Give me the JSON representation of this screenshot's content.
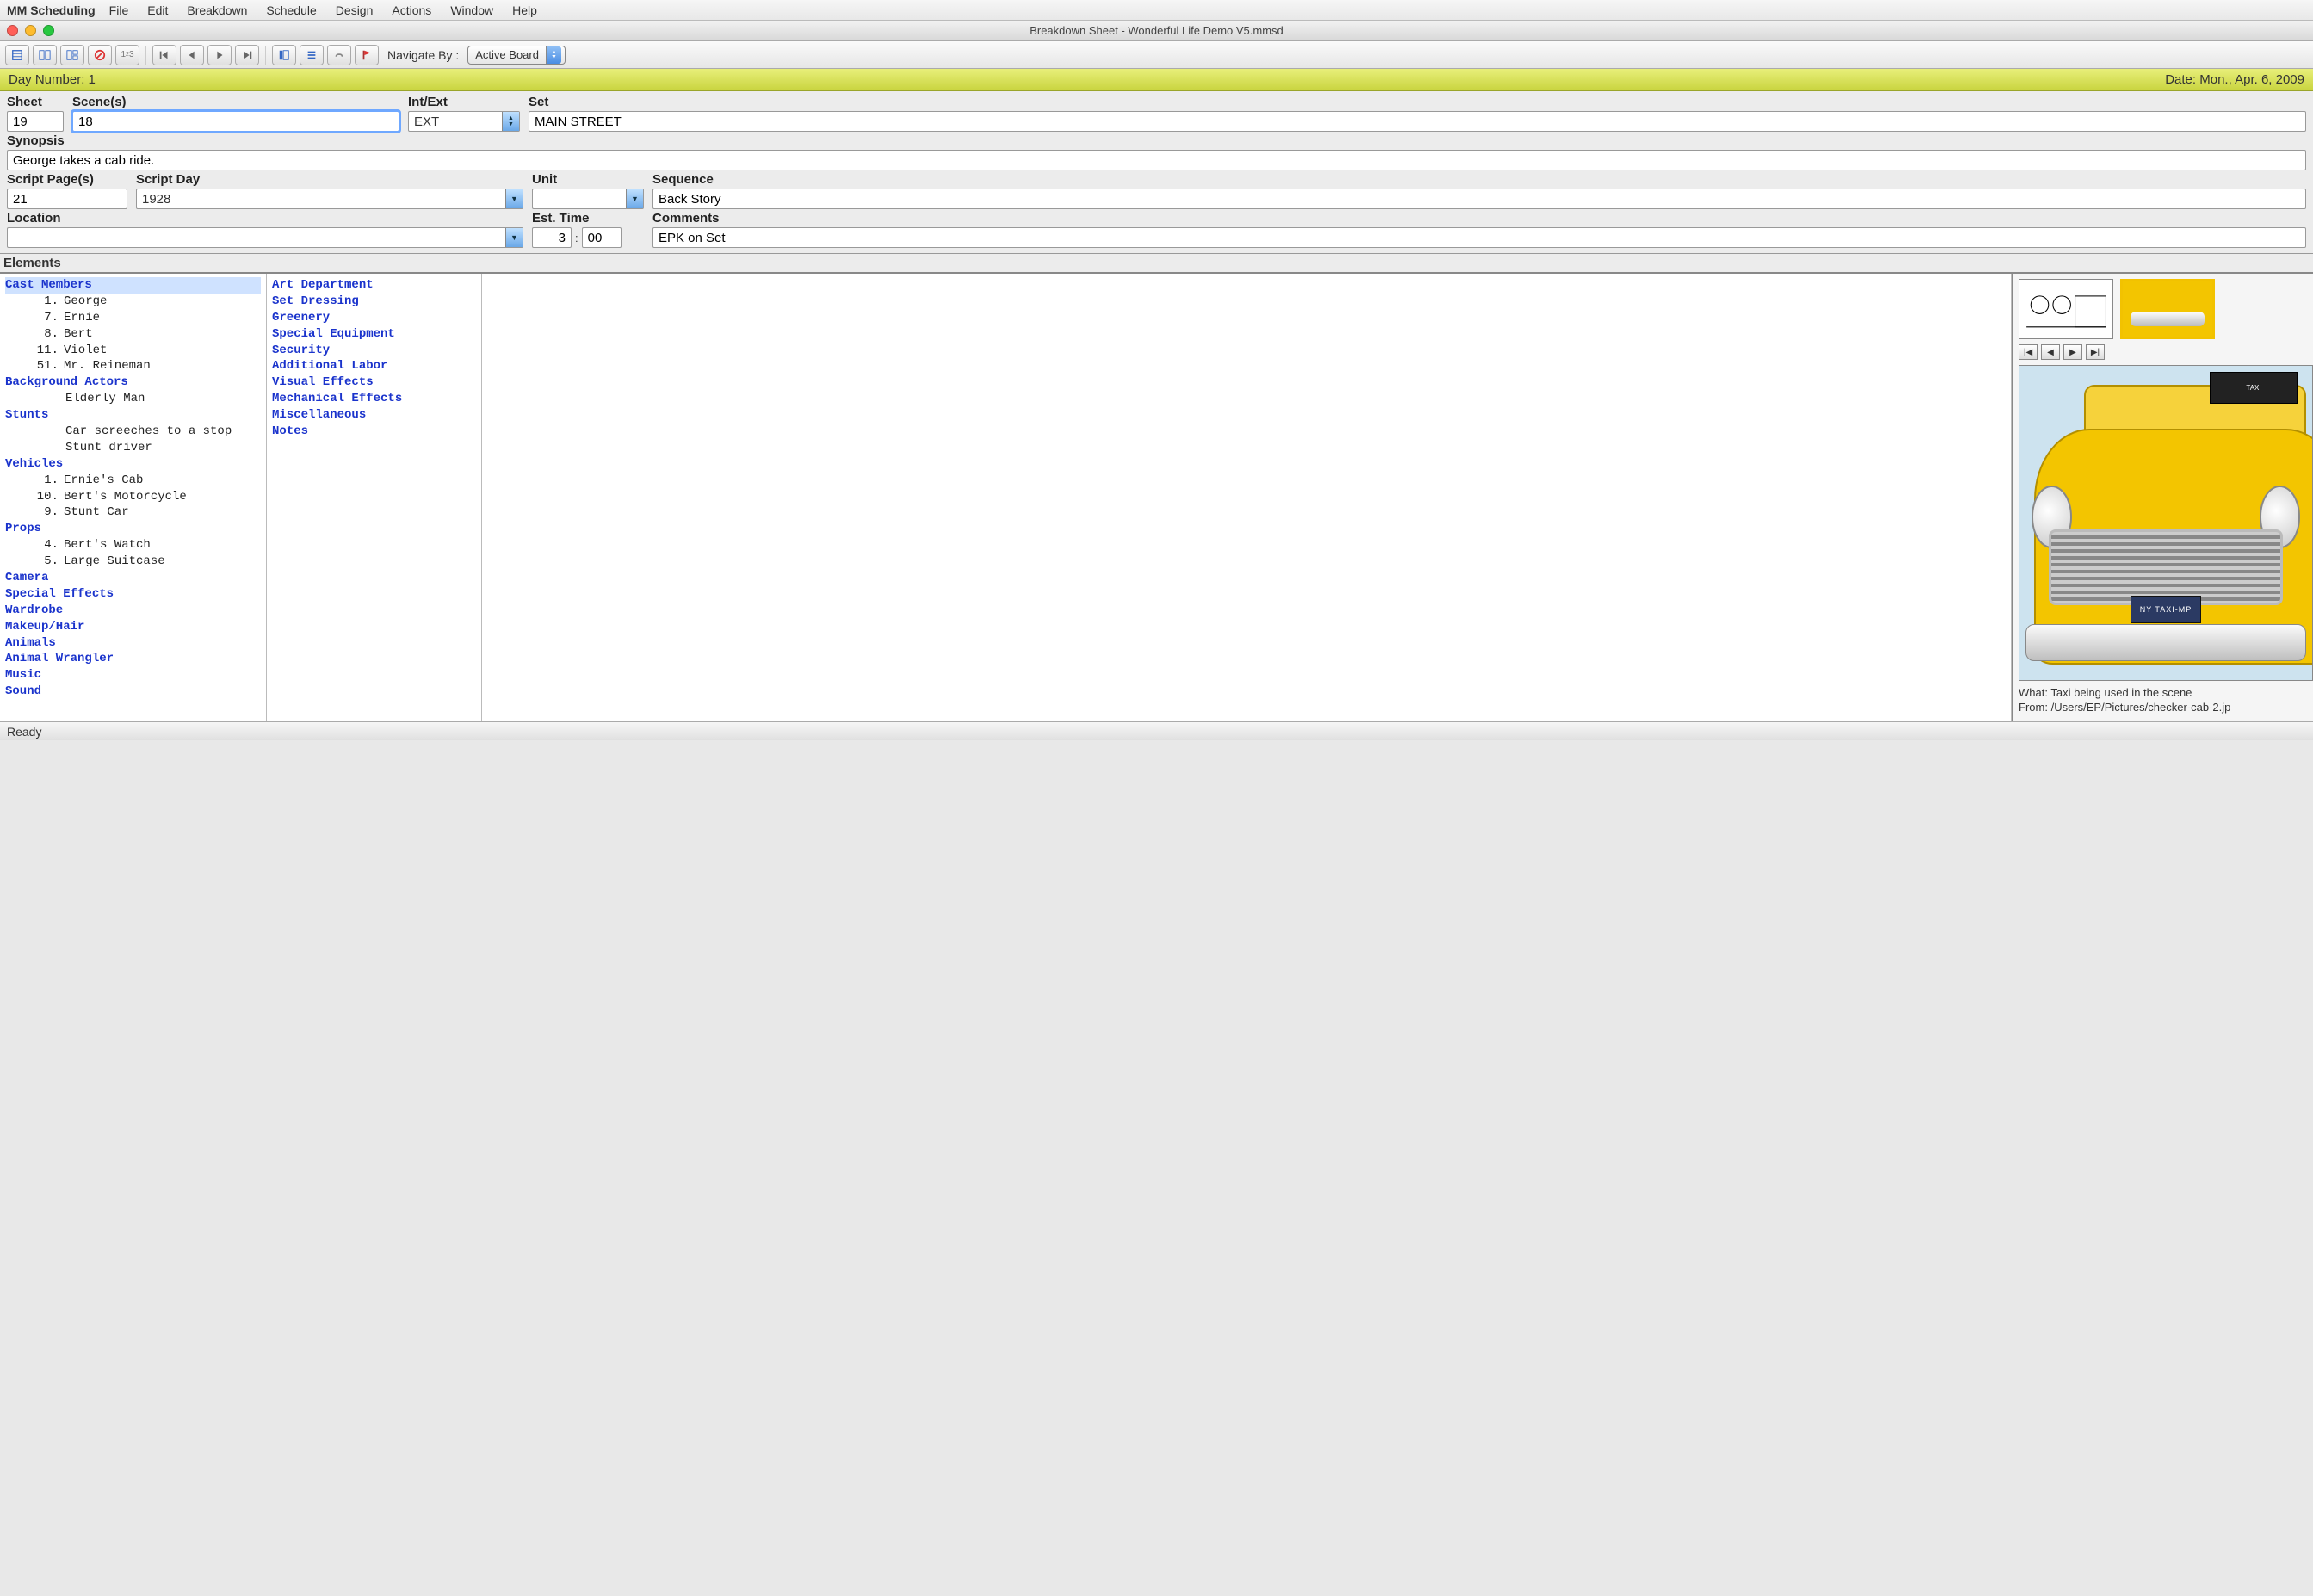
{
  "app_name": "MM Scheduling",
  "menubar": [
    "File",
    "Edit",
    "Breakdown",
    "Schedule",
    "Design",
    "Actions",
    "Window",
    "Help"
  ],
  "window_title": "Breakdown Sheet - Wonderful Life Demo V5.mmsd",
  "navigate_label": "Navigate By :",
  "navigate_value": "Active Board",
  "daybar": {
    "day_label": "Day Number: 1",
    "date_label": "Date: Mon., Apr. 6, 2009"
  },
  "labels": {
    "sheet": "Sheet",
    "scenes": "Scene(s)",
    "intext": "Int/Ext",
    "set": "Set",
    "synopsis": "Synopsis",
    "script_pages": "Script Page(s)",
    "script_day": "Script Day",
    "unit": "Unit",
    "sequence": "Sequence",
    "location": "Location",
    "est_time": "Est. Time",
    "comments": "Comments",
    "elements": "Elements",
    "time_sep": ":"
  },
  "values": {
    "sheet": "19",
    "scenes": "18",
    "intext": "EXT",
    "set": "MAIN STREET",
    "synopsis": "George takes a cab ride.",
    "script_pages": "21",
    "script_day": "1928",
    "unit": "",
    "sequence": "Back Story",
    "location": "",
    "est_time_h": "3",
    "est_time_m": "00",
    "comments": "EPK on Set"
  },
  "elements_col1": [
    {
      "type": "header",
      "text": "Cast Members",
      "selected": true
    },
    {
      "type": "item",
      "num": "1.",
      "text": "George"
    },
    {
      "type": "item",
      "num": "7.",
      "text": "Ernie"
    },
    {
      "type": "item",
      "num": "8.",
      "text": "Bert"
    },
    {
      "type": "item",
      "num": "11.",
      "text": "Violet"
    },
    {
      "type": "item",
      "num": "51.",
      "text": "Mr. Reineman"
    },
    {
      "type": "header",
      "text": "Background Actors"
    },
    {
      "type": "item",
      "text": "Elderly Man"
    },
    {
      "type": "header",
      "text": "Stunts"
    },
    {
      "type": "item",
      "text": "Car screeches to a stop"
    },
    {
      "type": "item",
      "text": "Stunt driver"
    },
    {
      "type": "header",
      "text": "Vehicles"
    },
    {
      "type": "item",
      "num": "1.",
      "text": "Ernie's Cab"
    },
    {
      "type": "item",
      "num": "10.",
      "text": "Bert's Motorcycle"
    },
    {
      "type": "item",
      "num": "9.",
      "text": "Stunt Car"
    },
    {
      "type": "header",
      "text": "Props"
    },
    {
      "type": "item",
      "num": "4.",
      "text": "Bert's Watch"
    },
    {
      "type": "item",
      "num": "5.",
      "text": "Large Suitcase"
    },
    {
      "type": "header",
      "text": "Camera"
    },
    {
      "type": "header",
      "text": "Special Effects"
    },
    {
      "type": "header",
      "text": "Wardrobe"
    },
    {
      "type": "header",
      "text": "Makeup/Hair"
    },
    {
      "type": "header",
      "text": "Animals"
    },
    {
      "type": "header",
      "text": "Animal Wrangler"
    },
    {
      "type": "header",
      "text": "Music"
    },
    {
      "type": "header",
      "text": "Sound"
    }
  ],
  "elements_col2": [
    "Art Department",
    "Set Dressing",
    "Greenery",
    "Special Equipment",
    "Security",
    "Additional Labor",
    "Visual Effects",
    "Mechanical Effects",
    "Miscellaneous",
    "Notes"
  ],
  "image_meta": {
    "what_label": "What:",
    "what_value": "Taxi being used in the scene",
    "from_label": "From:",
    "from_value": "/Users/EP/Pictures/checker-cab-2.jp"
  },
  "taxi_plate": "NY TAXI-MP",
  "taxi_sign": "TAXI",
  "status": "Ready"
}
